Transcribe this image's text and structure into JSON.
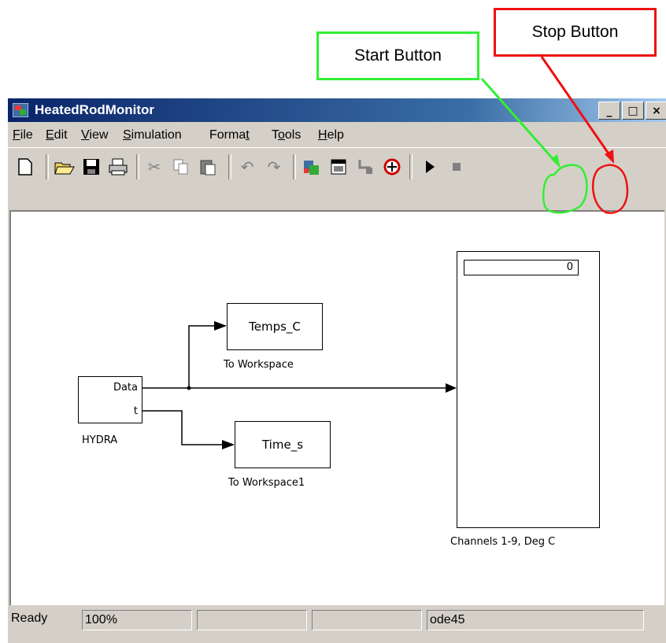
{
  "callouts": {
    "start": "Start Button",
    "stop": "Stop Button"
  },
  "window": {
    "title": "HeatedRodMonitor",
    "controls": [
      "_",
      "□",
      "×"
    ]
  },
  "menu": [
    {
      "label": "File",
      "accel": "F",
      "rest": "ile"
    },
    {
      "label": "Edit",
      "accel": "E",
      "rest": "dit"
    },
    {
      "label": "View",
      "accel": "V",
      "rest": "iew"
    },
    {
      "label": "Simulation",
      "accel": "S",
      "rest": "imulation"
    },
    {
      "label": "Format",
      "pre": "Forma",
      "accel": "t",
      "rest": ""
    },
    {
      "label": "Tools",
      "pre": "T",
      "accel": "o",
      "rest": "ols"
    },
    {
      "label": "Help",
      "accel": "H",
      "rest": "elp"
    }
  ],
  "toolbar": {
    "icons": [
      "new-file-icon",
      "open-folder-icon",
      "save-icon",
      "print-icon",
      "cut-icon",
      "copy-icon",
      "paste-icon",
      "undo-icon",
      "redo-icon",
      "library-browser-icon",
      "model-explorer-icon",
      "debugger-icon",
      "target-icon",
      "start-icon",
      "stop-icon"
    ]
  },
  "diagram": {
    "hydra": {
      "label": "HYDRA",
      "port_data": "Data",
      "port_t": "t"
    },
    "temps": {
      "text": "Temps_C",
      "label": "To Workspace"
    },
    "time": {
      "text": "Time_s",
      "label": "To Workspace1"
    },
    "scope": {
      "display": "0",
      "label": "Channels 1-9, Deg C"
    }
  },
  "status": {
    "state": "Ready",
    "zoom": "100%",
    "field3": "",
    "field4": "",
    "solver": "ode45"
  },
  "colors": {
    "start_outline": "#33ee33",
    "stop_outline": "#ee1111",
    "titlebar": "#0a246a"
  }
}
